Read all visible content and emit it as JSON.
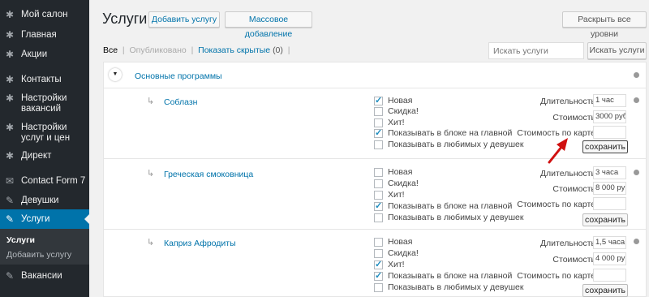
{
  "sidebar": {
    "items": [
      {
        "label": "Мой салон",
        "icon": "gear-icon"
      },
      {
        "label": "Главная",
        "icon": "gear-icon"
      },
      {
        "label": "Акции",
        "icon": "gear-icon"
      },
      {
        "label": "Контакты",
        "icon": "gear-icon"
      },
      {
        "label": "Настройки вакансий",
        "icon": "gear-icon"
      },
      {
        "label": "Настройки услуг и цен",
        "icon": "gear-icon"
      },
      {
        "label": "Директ",
        "icon": "gear-icon"
      },
      {
        "label": "Contact Form 7",
        "icon": "envelope-icon"
      },
      {
        "label": "Девушки",
        "icon": "pin-icon"
      },
      {
        "label": "Услуги",
        "icon": "pin-icon"
      },
      {
        "label": "Вакансии",
        "icon": "pin-icon"
      }
    ],
    "submenu": [
      "Услуги",
      "Добавить услугу"
    ]
  },
  "header": {
    "title": "Услуги",
    "add_label": "Добавить услугу",
    "bulk_label": "Массовое добавление",
    "expand_label": "Раскрыть все уровни"
  },
  "filters": {
    "all": "Все",
    "published": "Опубликовано",
    "show_hidden": "Показать скрытые",
    "hidden_count": "(0)"
  },
  "search": {
    "placeholder": "Искать услуги",
    "button": "Искать услуги"
  },
  "category": {
    "name": "Основные программы"
  },
  "labels": {
    "new": "Новая",
    "discount": "Скидка!",
    "hit": "Хит!",
    "show_home": "Показывать в блоке на главной",
    "show_fav": "Показывать в любимых у девушек",
    "duration": "Длительность",
    "price": "Стоимость",
    "card_price": "Стоимость по карте",
    "save": "сохранить"
  },
  "services": [
    {
      "name": "Соблазн",
      "checks": [
        true,
        false,
        false,
        true,
        false
      ],
      "duration": "1 час",
      "price": "3000 руб.",
      "card_price": ""
    },
    {
      "name": "Греческая смоковница",
      "checks": [
        false,
        false,
        false,
        true,
        false
      ],
      "duration": "3 часа",
      "price": "8 000 руб.",
      "card_price": ""
    },
    {
      "name": "Каприз Афродиты",
      "checks": [
        false,
        false,
        true,
        true,
        false
      ],
      "duration": "1,5 часа",
      "price": "4 000 руб.",
      "card_price": ""
    }
  ],
  "colors": {
    "sidebar": "#23282d",
    "active": "#0073aa",
    "link": "#0073aa",
    "arrow": "#d01010"
  }
}
